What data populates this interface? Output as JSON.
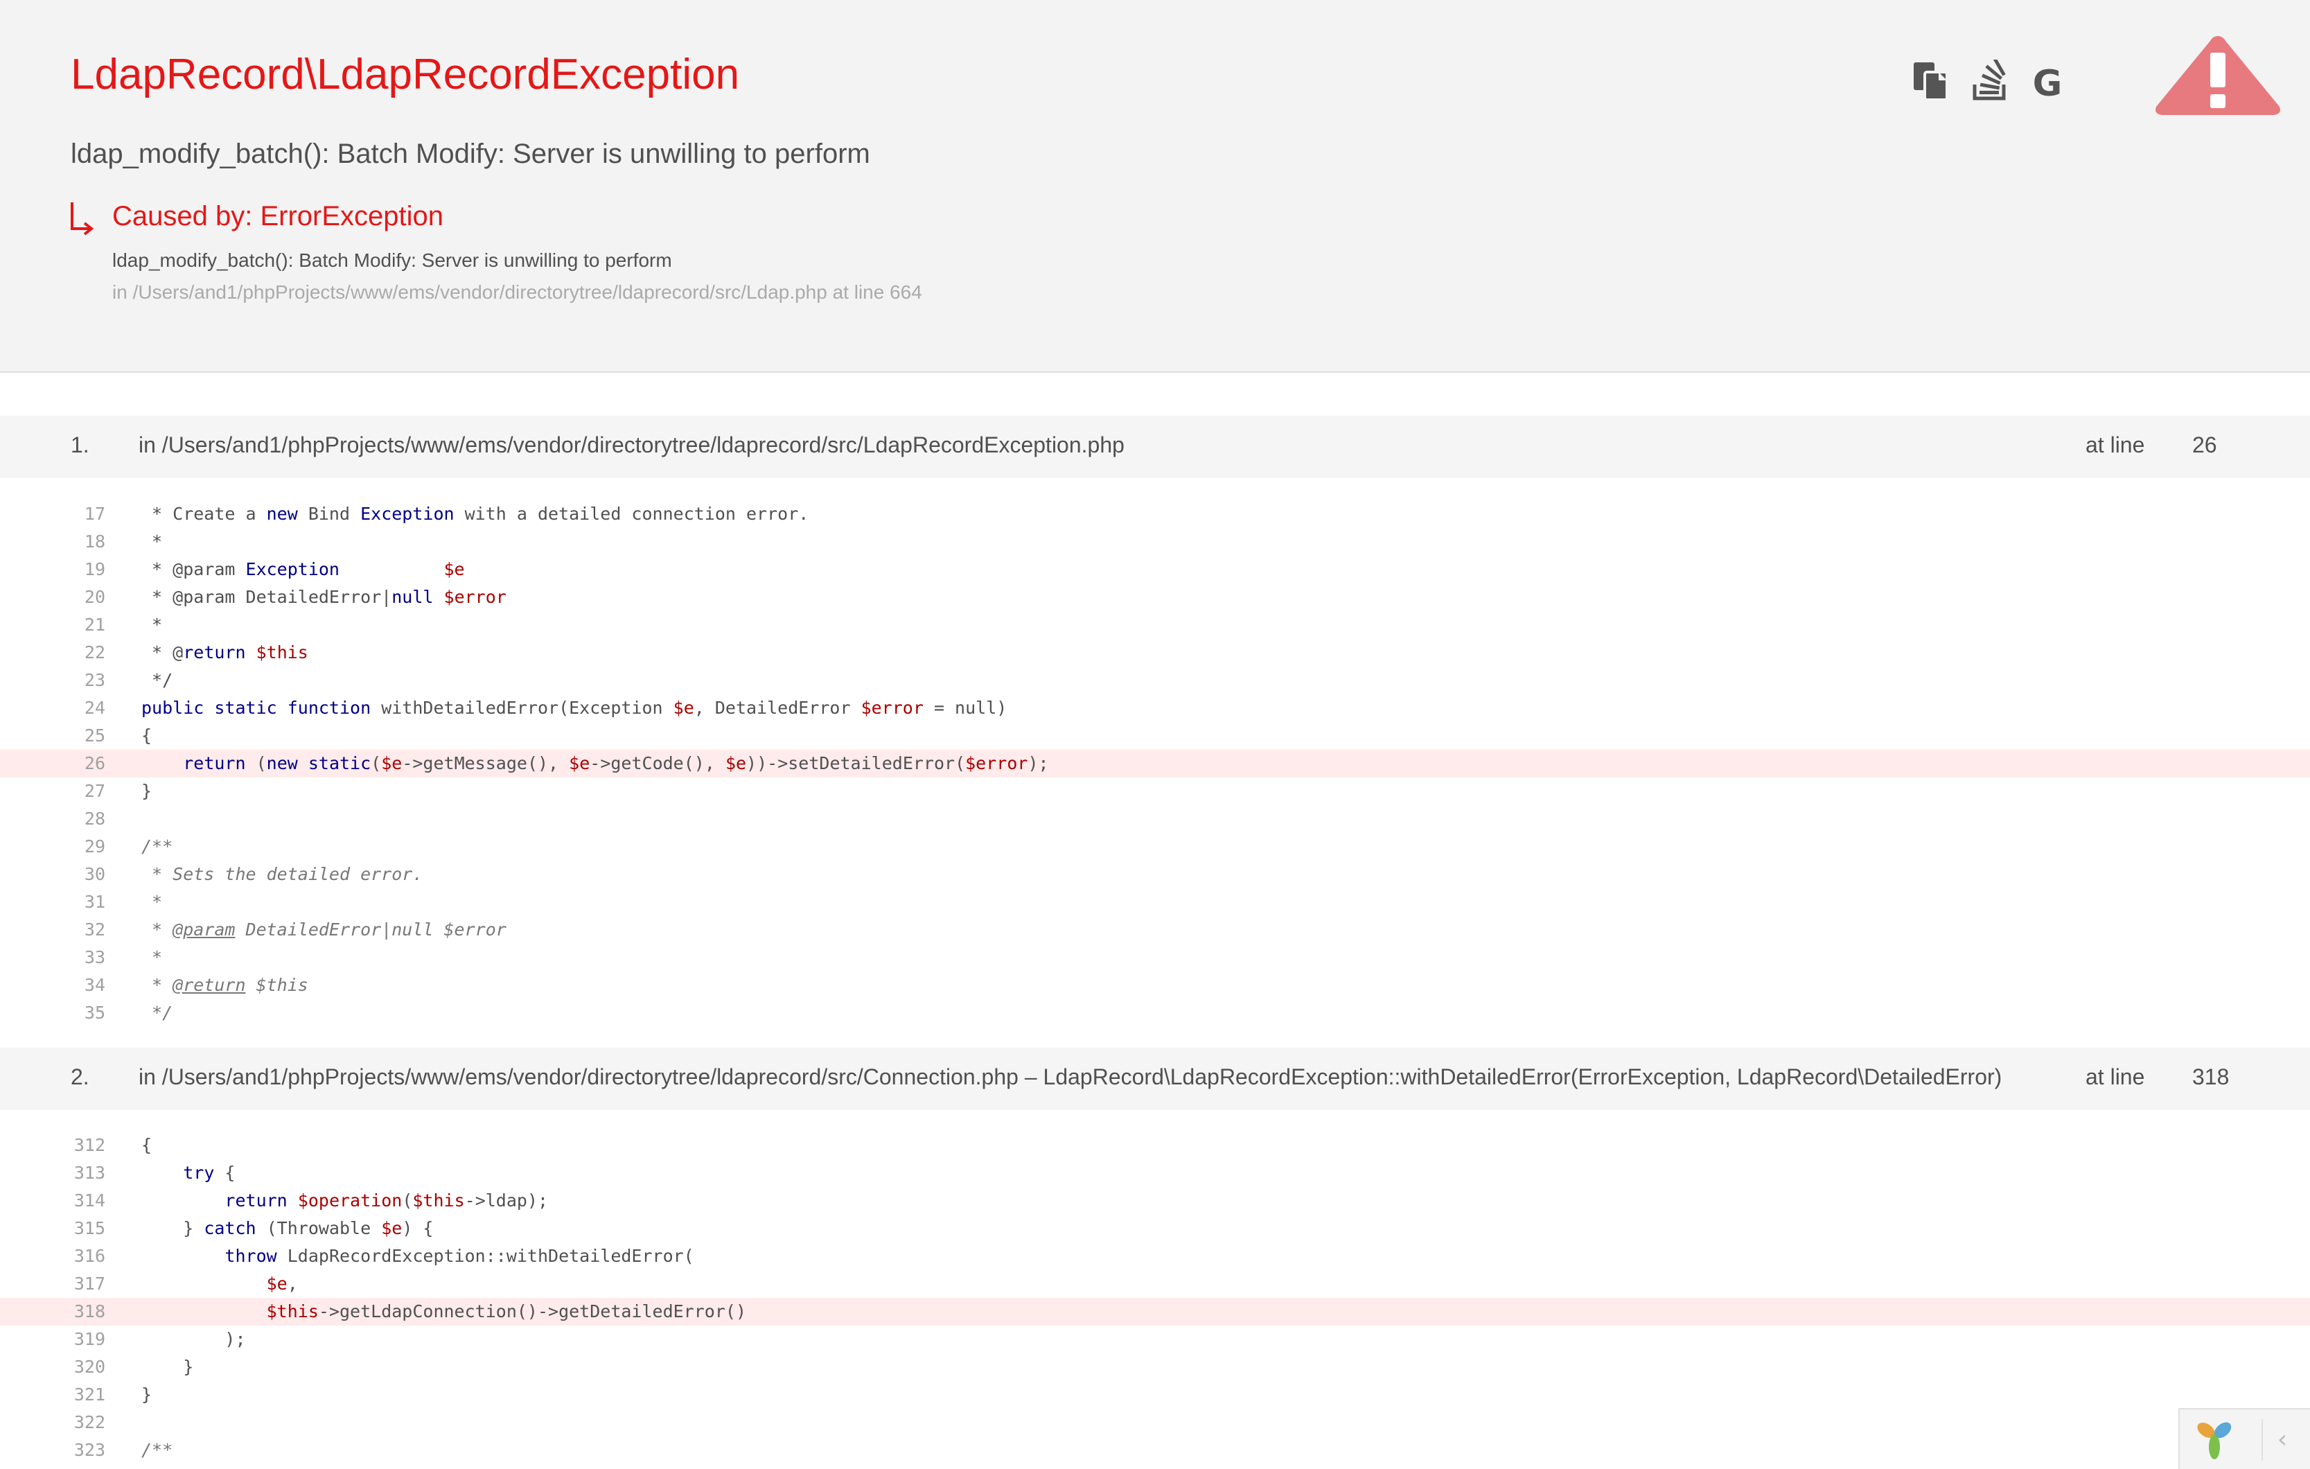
{
  "header": {
    "exception_class": "LdapRecord\\LdapRecordException",
    "message": "ldap_modify_batch(): Batch Modify: Server is unwilling to perform",
    "caused_by_title": "Caused by: ErrorException",
    "caused_by_message": "ldap_modify_batch(): Batch Modify: Server is unwilling to perform",
    "caused_by_file": "in /Users/and1/phpProjects/www/ems/vendor/directorytree/ldaprecord/src/Ldap.php at line 664"
  },
  "toolbar": {
    "copy_icon": "copy-icon",
    "stackoverflow_icon": "stackoverflow-icon",
    "google_icon": "google-icon",
    "google_label": "G",
    "warning_icon": "warning-icon"
  },
  "frames": [
    {
      "number": "1.",
      "file": "in /Users/and1/phpProjects/www/ems/vendor/directorytree/ldaprecord/src/LdapRecordException.php",
      "at_line_label": "at line",
      "line": "26"
    },
    {
      "number": "2.",
      "file": "in /Users/and1/phpProjects/www/ems/vendor/directorytree/ldaprecord/src/Connection.php – LdapRecord\\LdapRecordException::withDetailedError(ErrorException, LdapRecord\\DetailedError)",
      "at_line_label": "at line",
      "line": "318"
    }
  ],
  "code1_numbers": [
    "17",
    "18",
    "19",
    "20",
    "21",
    "22",
    "23",
    "24",
    "25",
    "26",
    "27",
    "28",
    "29",
    "30",
    "31",
    "32",
    "33",
    "34",
    "35"
  ],
  "code2_numbers": [
    "312",
    "313",
    "314",
    "315",
    "316",
    "317",
    "318",
    "319",
    "320",
    "321",
    "322",
    "323"
  ],
  "colors": {
    "error_red": "#e51717",
    "highlight_row": "#ffebeb",
    "keyword": "#000088",
    "variable": "#aa0000",
    "header_bg": "#f3f3f3"
  },
  "corner": {
    "logo_icon": "yii-logo-icon",
    "collapse_icon": "chevron-left-icon",
    "collapse_label": "‹"
  }
}
